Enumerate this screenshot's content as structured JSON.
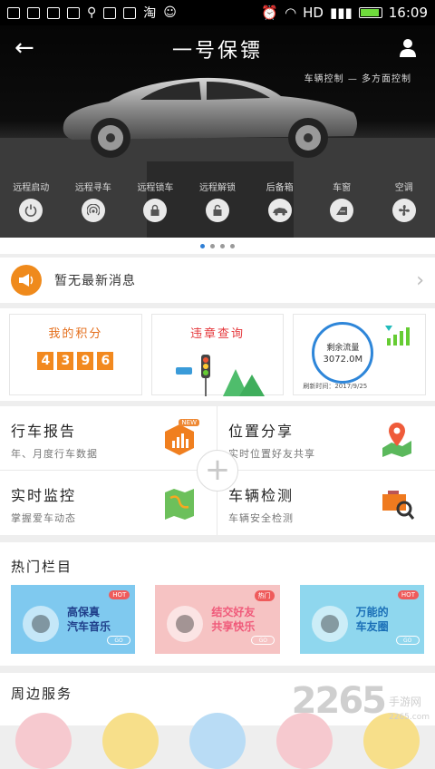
{
  "status_bar": {
    "carrier_glyph": "淘",
    "net": "HD",
    "time": "16:09"
  },
  "header": {
    "title": "一号保镖",
    "tagline": "车辆控制 — 多方面控制"
  },
  "controls": [
    {
      "label": "远程启动",
      "icon": "power-icon"
    },
    {
      "label": "远程寻车",
      "icon": "signal-icon"
    },
    {
      "label": "远程锁车",
      "icon": "lock-icon"
    },
    {
      "label": "远程解锁",
      "icon": "unlock-icon"
    },
    {
      "label": "后备箱",
      "icon": "trunk-icon"
    },
    {
      "label": "车窗",
      "icon": "window-icon"
    },
    {
      "label": "空调",
      "icon": "fan-icon"
    }
  ],
  "carousel": {
    "count": 4,
    "active": 0
  },
  "notice": {
    "text": "暂无最新消息"
  },
  "cards": {
    "points": {
      "title": "我的积分",
      "digits": [
        "4",
        "3",
        "9",
        "6"
      ]
    },
    "violation": {
      "title": "违章查询"
    },
    "traffic": {
      "label": "剩余流量",
      "value": "3072.0M",
      "updated": "刷新时间：2017/9/25"
    }
  },
  "features": [
    {
      "title": "行车报告",
      "subtitle": "年、月度行车数据",
      "badge": "NEW"
    },
    {
      "title": "位置分享",
      "subtitle": "实时位置好友共享"
    },
    {
      "title": "实时监控",
      "subtitle": "掌握爱车动态"
    },
    {
      "title": "车辆检测",
      "subtitle": "车辆安全检测"
    }
  ],
  "hot": {
    "title": "热门栏目",
    "banners": [
      {
        "tag": "HOT",
        "line1": "高保真",
        "line2": "汽车音乐",
        "go": "GO",
        "bg": "#7fc9ef",
        "color": "#1f3e8a"
      },
      {
        "tag": "热门",
        "line1": "结交好友",
        "line2": "共享快乐",
        "go": "GO",
        "bg": "#f6c3c3",
        "color": "#f05a7a"
      },
      {
        "tag": "HOT",
        "line1": "万能的",
        "line2": "车友圈",
        "go": "GO",
        "bg": "#8fd7ee",
        "color": "#1a6fb7"
      }
    ]
  },
  "nearby": {
    "title": "周边服务"
  },
  "watermark": {
    "big": "2265",
    "small": "手游网",
    "url": "2265.com"
  },
  "colors": {
    "accent": "#ef8a1c",
    "blue": "#2e86d9"
  }
}
